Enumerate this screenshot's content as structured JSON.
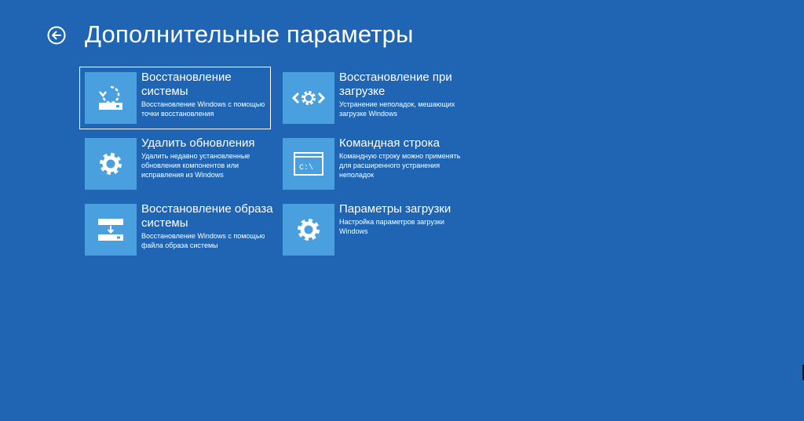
{
  "header": {
    "title": "Дополнительные параметры"
  },
  "options": [
    {
      "title": "Восстановление системы",
      "description": "Восстановление Windows с помощью точки восстановления",
      "icon": "system-restore-icon"
    },
    {
      "title": "Восстановление при загрузке",
      "description": "Устранение неполадок, мешающих загрузке Windows",
      "icon": "startup-repair-icon"
    },
    {
      "title": "Удалить обновления",
      "description": "Удалить недавно установленные обновления компонентов или исправления из Windows",
      "icon": "gear-icon"
    },
    {
      "title": "Командная строка",
      "description": "Командную строку можно применять для расширенного устранения неполадок",
      "icon": "command-prompt-icon",
      "prompt_text": "C:\\"
    },
    {
      "title": "Восстановление образа системы",
      "description": "Восстановление Windows с помощью файла образа системы",
      "icon": "system-image-recovery-icon"
    },
    {
      "title": "Параметры загрузки",
      "description": "Настройка параметров загрузки Windows",
      "icon": "gear-icon"
    }
  ],
  "colors": {
    "background": "#2065b4",
    "tile_icon_bg": "#4a9fde",
    "text": "#ffffff"
  }
}
